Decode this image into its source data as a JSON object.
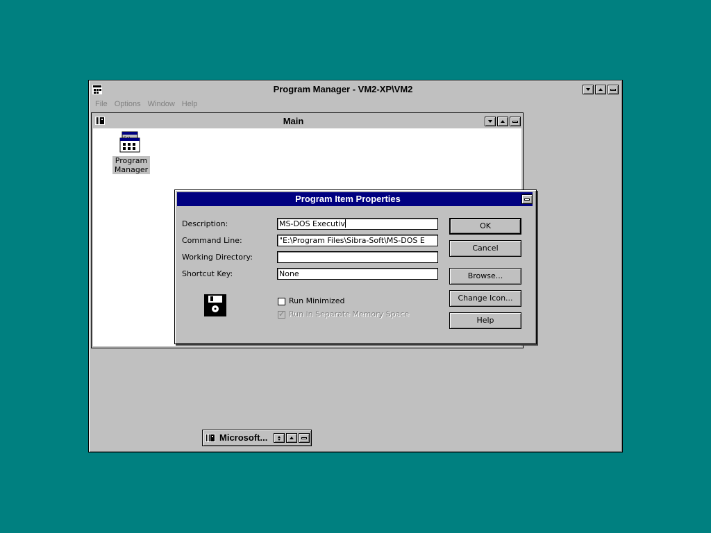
{
  "program_manager": {
    "title": "Program Manager - VM2-XP\\VM2",
    "menu": [
      "File",
      "Options",
      "Window",
      "Help"
    ]
  },
  "main_group": {
    "title": "Main",
    "icon_label_line1": "Program",
    "icon_label_line2": "Manager"
  },
  "dialog": {
    "title": "Program Item Properties",
    "fields": {
      "description_label": "Description:",
      "description_value": "MS-DOS Executiv",
      "command_label": "Command Line:",
      "command_value": "\"E:\\Program Files\\Sibra-Soft\\MS-DOS E",
      "workdir_label": "Working Directory:",
      "workdir_value": "",
      "shortcut_label": "Shortcut Key:",
      "shortcut_value": "None"
    },
    "checks": {
      "run_minimized": "Run Minimized",
      "run_separate": "Run in Separate Memory Space"
    },
    "buttons": {
      "ok": "OK",
      "cancel": "Cancel",
      "browse": "Browse...",
      "change_icon": "Change Icon...",
      "help": "Help"
    }
  },
  "minimized_group": {
    "title": "Microsoft..."
  },
  "colors": {
    "desktop": "#008080",
    "active_caption": "#000080",
    "face": "#c0c0c0"
  }
}
